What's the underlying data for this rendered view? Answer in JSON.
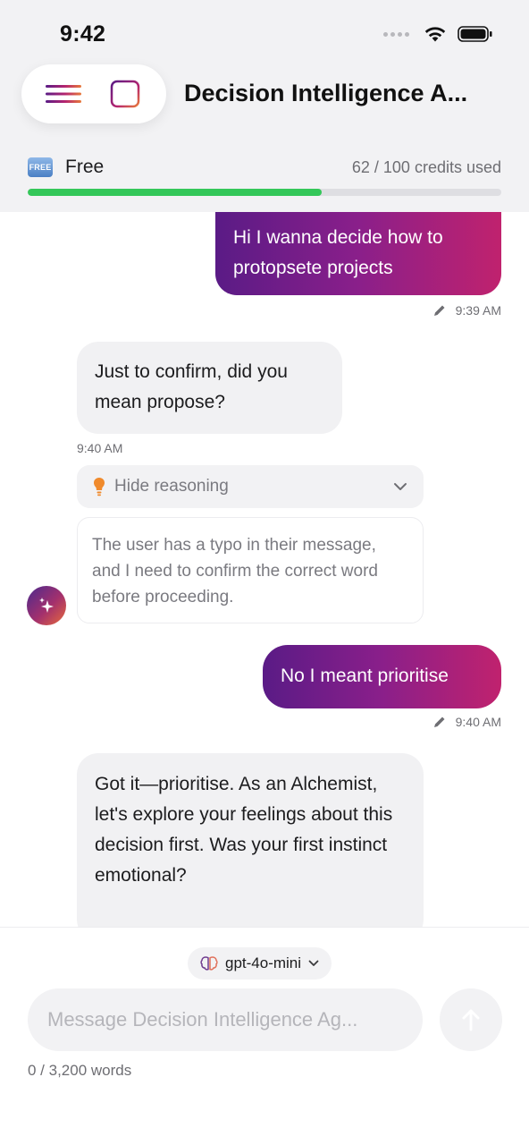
{
  "status_bar": {
    "time": "9:42"
  },
  "header": {
    "title": "Decision Intelligence A...",
    "menu_icon": "menu-icon",
    "sidebar_icon": "sidebar-icon"
  },
  "plan": {
    "badge": "FREE",
    "name": "Free",
    "credits_text": "62 / 100 credits used",
    "credits_used": 62,
    "credits_total": 100,
    "progress_color": "#34c759"
  },
  "messages": [
    {
      "role": "user",
      "text": "Hi I wanna decide how to protopsete projects",
      "time": "9:39 AM"
    },
    {
      "role": "assistant",
      "text": "Just to confirm, did you mean propose?",
      "time": "9:40 AM"
    },
    {
      "role": "user",
      "text": "No I meant prioritise",
      "time": "9:40 AM"
    },
    {
      "role": "assistant",
      "text": "Got it—prioritise. As an Alchemist, let's explore your feelings about this decision first. Was your first instinct emotional?"
    }
  ],
  "reasoning": {
    "toggle_label": "Hide reasoning",
    "text": "The user has a typo in their message, and I need to confirm the correct word before proceeding."
  },
  "composer": {
    "model": "gpt-4o-mini",
    "placeholder": "Message Decision Intelligence Ag...",
    "word_count": "0 / 3,200 words"
  },
  "colors": {
    "user_bubble_gradient": [
      "#5a1b86",
      "#c0226e"
    ],
    "assistant_bubble": "#f1f1f3",
    "accent_green": "#34c759"
  }
}
